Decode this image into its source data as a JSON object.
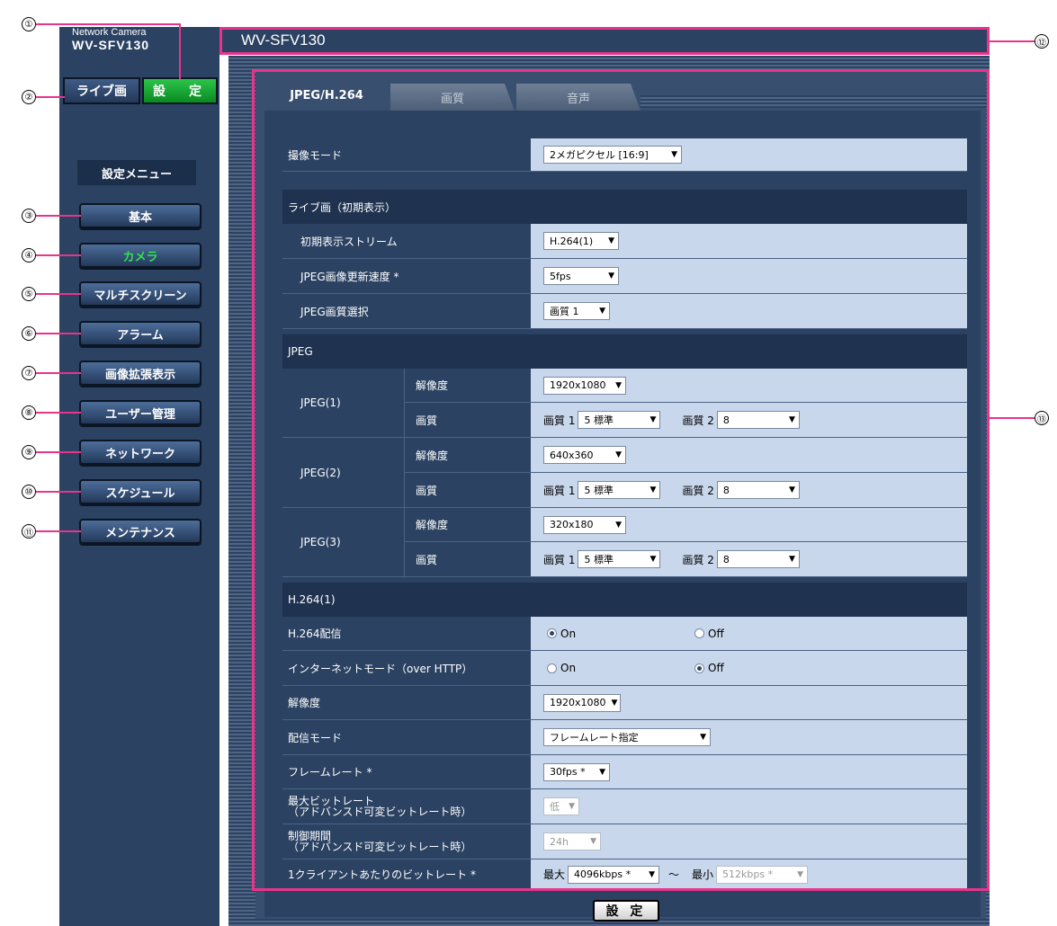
{
  "brand": {
    "line1": "Network Camera",
    "line2": "WV-SFV130"
  },
  "top_buttons": {
    "live": "ライブ画",
    "settings": "設　定"
  },
  "menu": {
    "title": "設定メニュー",
    "items": [
      "基本",
      "カメラ",
      "マルチスクリーン",
      "アラーム",
      "画像拡張表示",
      "ユーザー管理",
      "ネットワーク",
      "スケジュール",
      "メンテナンス"
    ],
    "active": "カメラ"
  },
  "header": {
    "title": "WV-SFV130"
  },
  "tabs": [
    "JPEG/H.264",
    "画質",
    "音声"
  ],
  "form": {
    "capture_mode": {
      "label": "撮像モード",
      "value": "2メガピクセル [16:9]"
    },
    "live_section": "ライブ画（初期表示）",
    "init_stream": {
      "label": "初期表示ストリーム",
      "value": "H.264(1)"
    },
    "jpeg_refresh": {
      "label": "JPEG画像更新速度 *",
      "value": "5fps"
    },
    "jpeg_quality_sel": {
      "label": "JPEG画質選択",
      "value": "画質 1"
    },
    "jpeg_section": "JPEG",
    "jpeg": [
      {
        "name": "JPEG(1)",
        "res_label": "解像度",
        "res": "1920x1080",
        "q_label": "画質",
        "q1_label": "画質 1",
        "q1": "5 標準",
        "q2_label": "画質 2",
        "q2": "8"
      },
      {
        "name": "JPEG(2)",
        "res_label": "解像度",
        "res": "640x360",
        "q_label": "画質",
        "q1_label": "画質 1",
        "q1": "5 標準",
        "q2_label": "画質 2",
        "q2": "8"
      },
      {
        "name": "JPEG(3)",
        "res_label": "解像度",
        "res": "320x180",
        "q_label": "画質",
        "q1_label": "画質 1",
        "q1": "5 標準",
        "q2_label": "画質 2",
        "q2": "8"
      }
    ],
    "h264_section": "H.264(1)",
    "h264_stream": {
      "label": "H.264配信",
      "on": "On",
      "off": "Off",
      "selected": "On"
    },
    "internet_mode": {
      "label": "インターネットモード（over HTTP）",
      "on": "On",
      "off": "Off",
      "selected": "Off"
    },
    "resolution": {
      "label": "解像度",
      "value": "1920x1080"
    },
    "dist_mode": {
      "label": "配信モード",
      "value": "フレームレート指定"
    },
    "frame_rate": {
      "label": "フレームレート *",
      "value": "30fps *"
    },
    "max_bitrate": {
      "label": "最大ビットレート\n（アドバンスド可変ビットレート時）",
      "value": "低"
    },
    "control_period": {
      "label": "制御期間\n（アドバンスド可変ビットレート時）",
      "value": "24h"
    },
    "bitrate_per_client": {
      "label": "1クライアントあたりのビットレート *",
      "max_label": "最大",
      "max": "4096kbps *",
      "tilde": "～",
      "min_label": "最小",
      "min": "512kbps *"
    }
  },
  "submit_label": "設 定",
  "callouts": [
    "①",
    "②",
    "③",
    "④",
    "⑤",
    "⑥",
    "⑦",
    "⑧",
    "⑨",
    "⑩",
    "⑪",
    "⑫",
    "⑬"
  ],
  "colors": {
    "sidebar": "#2b4262",
    "active_menu": "#2ee34d",
    "settings_button": "#13a52f",
    "value_bg": "#c8d7ec",
    "callout_pink": "#e8348b"
  }
}
